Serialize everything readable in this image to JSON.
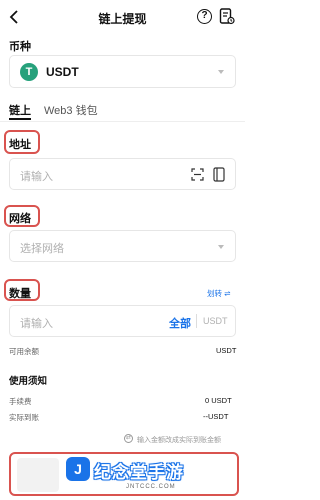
{
  "header": {
    "title": "链上提现",
    "help_label": "?"
  },
  "coin": {
    "label": "币种",
    "value": "USDT",
    "logo_letter": "T"
  },
  "tabs": [
    {
      "label": "链上",
      "active": true
    },
    {
      "label": "Web3 钱包",
      "active": false
    }
  ],
  "address": {
    "label": "地址",
    "placeholder": "请输入"
  },
  "network": {
    "label": "网络",
    "placeholder": "选择网络"
  },
  "amount": {
    "label": "数量",
    "transfer_label": "划转 ⇌",
    "placeholder": "请输入",
    "all_label": "全部",
    "unit": "USDT",
    "available_label": "可用余额",
    "available_unit": "USDT"
  },
  "notes": {
    "title": "使用须知",
    "fee_label": "手续费",
    "fee_value": "0 USDT",
    "received_label": "实际到账",
    "received_value": "--USDT",
    "hint": "输入金额改成实际到账金额"
  },
  "watermark": {
    "logo_letter": "J",
    "text": "纪念堂手游",
    "url": "JNTCCC.COM"
  },
  "colors": {
    "accent": "#1a73e8",
    "highlight": "#d9534f",
    "usdt": "#26a17b"
  }
}
